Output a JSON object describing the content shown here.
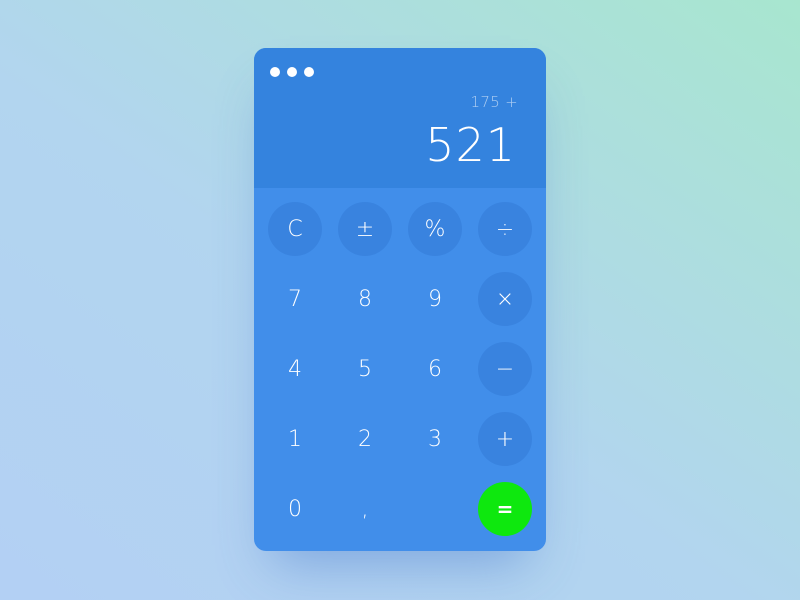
{
  "calculator": {
    "expression": "175 +",
    "result": "521",
    "keys": {
      "clear": "C",
      "plus_minus": "±",
      "percent": "%",
      "divide": "÷",
      "seven": "7",
      "eight": "8",
      "nine": "9",
      "multiply": "×",
      "four": "4",
      "five": "5",
      "six": "6",
      "minus": "−",
      "one": "1",
      "two": "2",
      "three": "3",
      "plus": "+",
      "zero": "0",
      "comma": ",",
      "equals": "="
    }
  },
  "colors": {
    "display_bg": "#3483de",
    "keypad_bg": "#418eea",
    "operator_circle": "#3983df",
    "equals_accent": "#0ee80e"
  }
}
